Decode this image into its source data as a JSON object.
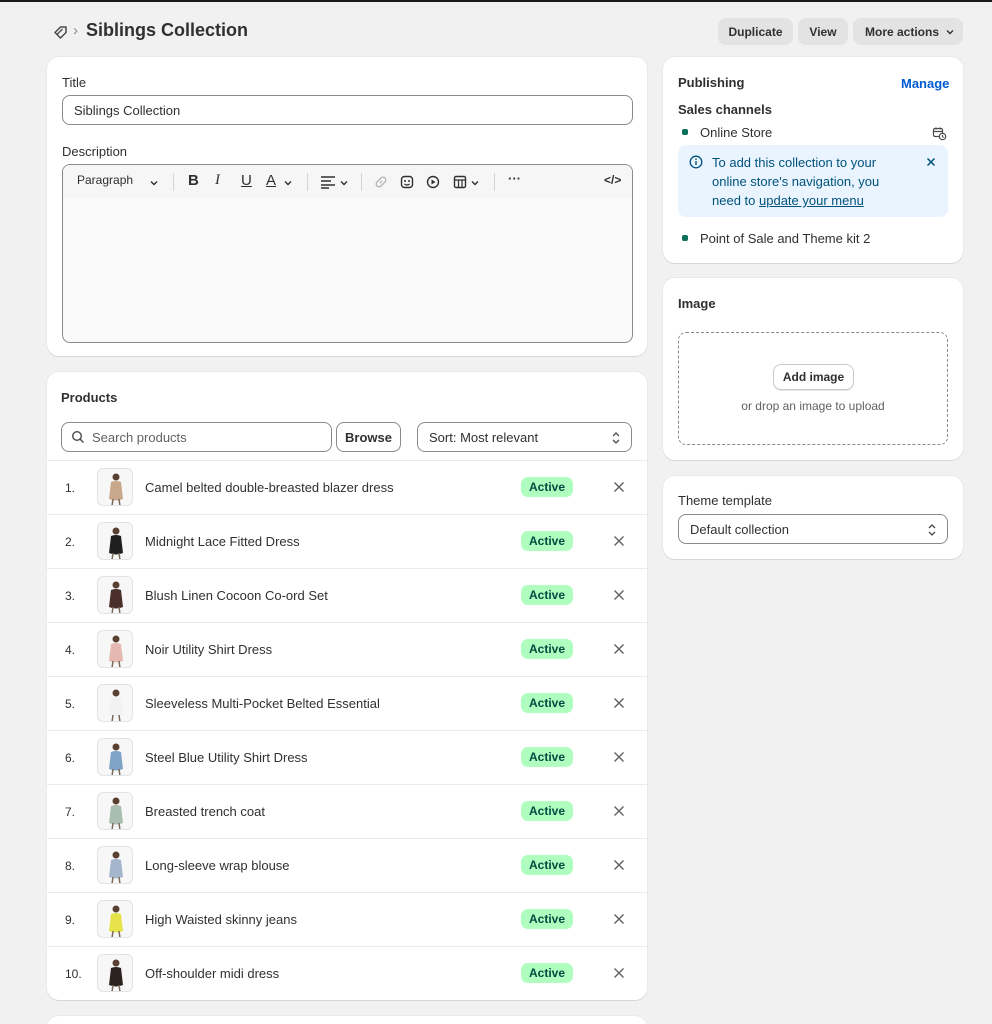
{
  "header": {
    "breadcrumb_sep": "›",
    "title": "Siblings Collection",
    "actions": {
      "duplicate": "Duplicate",
      "view": "View",
      "more": "More actions"
    }
  },
  "details": {
    "title_label": "Title",
    "title_value": "Siblings Collection",
    "description_label": "Description",
    "toolbar": {
      "paragraph": "Paragraph",
      "bold": "B",
      "italic": "I",
      "underline": "U",
      "text_color": "A",
      "more": "···",
      "code": "</>"
    }
  },
  "products": {
    "heading": "Products",
    "search_placeholder": "Search products",
    "browse_label": "Browse",
    "sort_label": "Sort: Most relevant",
    "items": [
      {
        "num": "1.",
        "name": "Camel belted double-breasted blazer dress",
        "status": "Active",
        "swatch": "#c8a88a"
      },
      {
        "num": "2.",
        "name": "Midnight Lace Fitted Dress",
        "status": "Active",
        "swatch": "#1f1f1f"
      },
      {
        "num": "3.",
        "name": "Blush Linen Cocoon Co-ord Set",
        "status": "Active",
        "swatch": "#4a2f2a"
      },
      {
        "num": "4.",
        "name": "Noir Utility Shirt Dress",
        "status": "Active",
        "swatch": "#e6b8b2"
      },
      {
        "num": "5.",
        "name": "Sleeveless Multi-Pocket Belted Essential",
        "status": "Active",
        "swatch": "#f2f2f2"
      },
      {
        "num": "6.",
        "name": "Steel Blue Utility Shirt Dress",
        "status": "Active",
        "swatch": "#7fa3c6"
      },
      {
        "num": "7.",
        "name": "Breasted trench coat",
        "status": "Active",
        "swatch": "#a9bdb0"
      },
      {
        "num": "8.",
        "name": "Long-sleeve wrap blouse",
        "status": "Active",
        "swatch": "#a5b6cc"
      },
      {
        "num": "9.",
        "name": "High Waisted skinny jeans",
        "status": "Active",
        "swatch": "#e6e24a"
      },
      {
        "num": "10.",
        "name": "Off-shoulder midi dress",
        "status": "Active",
        "swatch": "#2b2220"
      }
    ]
  },
  "publishing": {
    "heading": "Publishing",
    "manage_label": "Manage",
    "sales_channels_label": "Sales channels",
    "channel_1": "Online Store",
    "banner_text_1": "To add this collection to your online store's navigation, you need to ",
    "banner_link": "update your menu",
    "channel_2": "Point of Sale and Theme kit 2"
  },
  "image": {
    "heading": "Image",
    "add_label": "Add image",
    "drop_hint": "or drop an image to upload"
  },
  "theme": {
    "label": "Theme template",
    "value": "Default collection"
  },
  "colors": {
    "accent_link": "#005bd3",
    "badge_bg": "#affebf",
    "badge_text": "#014b40",
    "banner_bg": "#eaf4ff",
    "channel_dot": "#0d6e5a"
  }
}
